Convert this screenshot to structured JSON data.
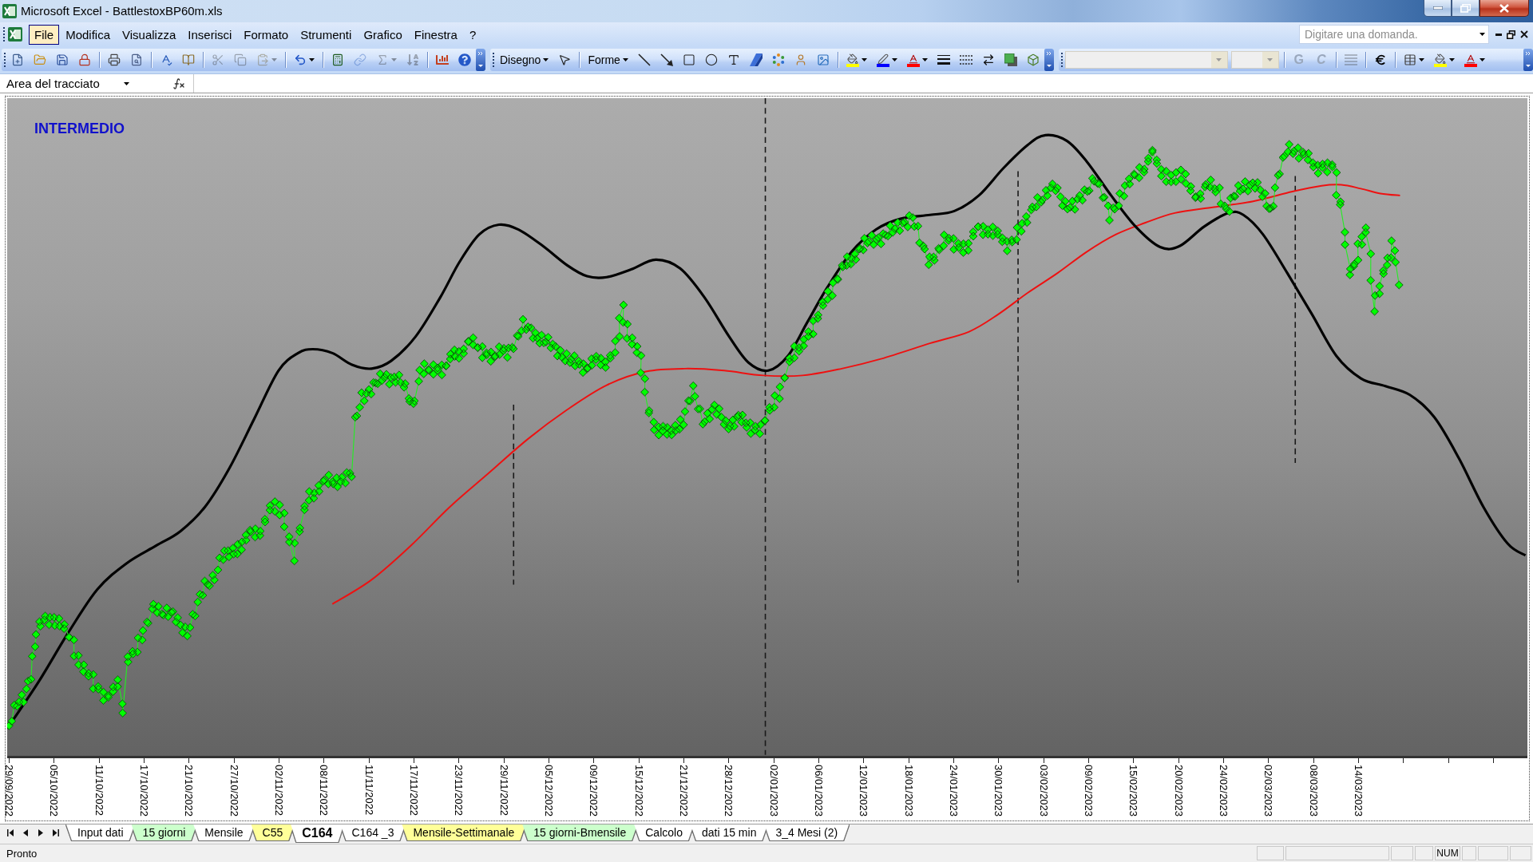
{
  "window": {
    "title": "Microsoft Excel - BattlestoxBP60m.xls"
  },
  "menu": [
    {
      "label": "File",
      "selected": true
    },
    {
      "label": "Modifica",
      "selected": false
    },
    {
      "label": "Visualizza",
      "selected": false
    },
    {
      "label": "Inserisci",
      "selected": false
    },
    {
      "label": "Formato",
      "selected": false
    },
    {
      "label": "Strumenti",
      "selected": false
    },
    {
      "label": "Grafico",
      "selected": false
    },
    {
      "label": "Finestra",
      "selected": false
    },
    {
      "label": "?",
      "selected": false
    }
  ],
  "help_box": {
    "placeholder": "Digitare una domanda."
  },
  "standard_toolbar": [
    [
      {
        "kind": "new",
        "disabled": false
      },
      {
        "kind": "open",
        "disabled": false
      },
      {
        "kind": "save",
        "disabled": false
      },
      {
        "kind": "permission",
        "disabled": false
      }
    ],
    [
      {
        "kind": "print",
        "disabled": false
      },
      {
        "kind": "preview",
        "disabled": false
      }
    ],
    [
      {
        "kind": "spelling",
        "disabled": false
      },
      {
        "kind": "research",
        "disabled": false
      }
    ],
    [
      {
        "kind": "cut",
        "disabled": true
      },
      {
        "kind": "copy",
        "disabled": true
      },
      {
        "kind": "paste",
        "disabled": true,
        "dropdown": true
      }
    ],
    [
      {
        "kind": "undo",
        "disabled": false,
        "dropdown": true
      }
    ],
    [
      {
        "kind": "eurotool",
        "disabled": false
      },
      {
        "kind": "hyperlink",
        "disabled": true
      },
      {
        "kind": "autosum",
        "disabled": true,
        "dropdown": true
      },
      {
        "kind": "sort",
        "disabled": true
      }
    ],
    [
      {
        "kind": "chart",
        "disabled": false
      },
      {
        "kind": "help",
        "disabled": false
      }
    ]
  ],
  "drawing_toolbar": [
    [
      {
        "kind": "menu",
        "label": "Disegno"
      },
      {
        "kind": "pointer"
      }
    ],
    [
      {
        "kind": "menu",
        "label": "Forme"
      },
      {
        "kind": "line"
      },
      {
        "kind": "arrow"
      },
      {
        "kind": "rectangle"
      },
      {
        "kind": "oval"
      },
      {
        "kind": "textbox"
      },
      {
        "kind": "wordart"
      },
      {
        "kind": "diagram"
      },
      {
        "kind": "clipart"
      },
      {
        "kind": "picture"
      }
    ],
    [
      {
        "kind": "fillcolor",
        "dropdown": true
      },
      {
        "kind": "linecolor",
        "dropdown": true
      },
      {
        "kind": "fontcolor",
        "dropdown": true
      },
      {
        "kind": "linestyle"
      },
      {
        "kind": "dashstyle"
      },
      {
        "kind": "arrowstyle"
      },
      {
        "kind": "shadow"
      },
      {
        "kind": "depth"
      }
    ]
  ],
  "formatting_toolbar": [
    [
      {
        "kind": "fontbox",
        "disabled": true
      },
      {
        "kind": "sizebox",
        "disabled": true
      }
    ],
    [
      {
        "kind": "bold",
        "label": "G",
        "disabled": true
      },
      {
        "kind": "italic",
        "label": "C",
        "disabled": true
      }
    ],
    [
      {
        "kind": "justify",
        "disabled": true
      }
    ],
    [
      {
        "kind": "euro",
        "disabled": false
      }
    ],
    [
      {
        "kind": "borders",
        "disabled": false,
        "dropdown": true
      },
      {
        "kind": "fillcolor",
        "disabled": false,
        "dropdown": true
      },
      {
        "kind": "fontcolor",
        "disabled": false,
        "dropdown": true
      }
    ]
  ],
  "formula_bar": {
    "name_box": "Area del tracciato"
  },
  "chart": {
    "title": "INTERMEDIO",
    "x_axis_labels": [
      "29/09/2022",
      "05/10/2022",
      "11/10/2022",
      "17/10/2022",
      "21/10/2022",
      "27/10/2022",
      "02/11/2022",
      "08/11/2022",
      "11/11/2022",
      "17/11/2022",
      "23/11/2022",
      "29/11/2022",
      "05/12/2022",
      "09/12/2022",
      "15/12/2022",
      "21/12/2022",
      "28/12/2022",
      "02/01/2023",
      "06/01/2023",
      "12/01/2023",
      "18/01/2023",
      "24/01/2023",
      "30/01/2023",
      "03/02/2023",
      "09/02/2023",
      "15/02/2023",
      "20/02/2023",
      "24/02/2023",
      "02/03/2023",
      "08/03/2023",
      "14/03/2023"
    ]
  },
  "sheet_tabs": [
    {
      "label": "Input dati",
      "selected": false,
      "color": "#ffffff"
    },
    {
      "label": "15 giorni",
      "selected": false,
      "color": "#ccffcc"
    },
    {
      "label": "Mensile",
      "selected": false,
      "color": "#ffffff"
    },
    {
      "label": "C55",
      "selected": false,
      "color": "#ffff99"
    },
    {
      "label": "C164",
      "selected": true,
      "color": "#ffffff"
    },
    {
      "label": "C164 _3",
      "selected": false,
      "color": "#ffffff"
    },
    {
      "label": "Mensile-Settimanale",
      "selected": false,
      "color": "#ffff99"
    },
    {
      "label": "15 giorni-Bmensile",
      "selected": false,
      "color": "#ccffcc"
    },
    {
      "label": "Calcolo",
      "selected": false,
      "color": "#ffffff"
    },
    {
      "label": "dati 15 min",
      "selected": false,
      "color": "#ffffff"
    },
    {
      "label": "3_4 Mesi (2)",
      "selected": false,
      "color": "#ffffff"
    }
  ],
  "status_bar": {
    "message": "Pronto",
    "indicator": "NUM"
  }
}
